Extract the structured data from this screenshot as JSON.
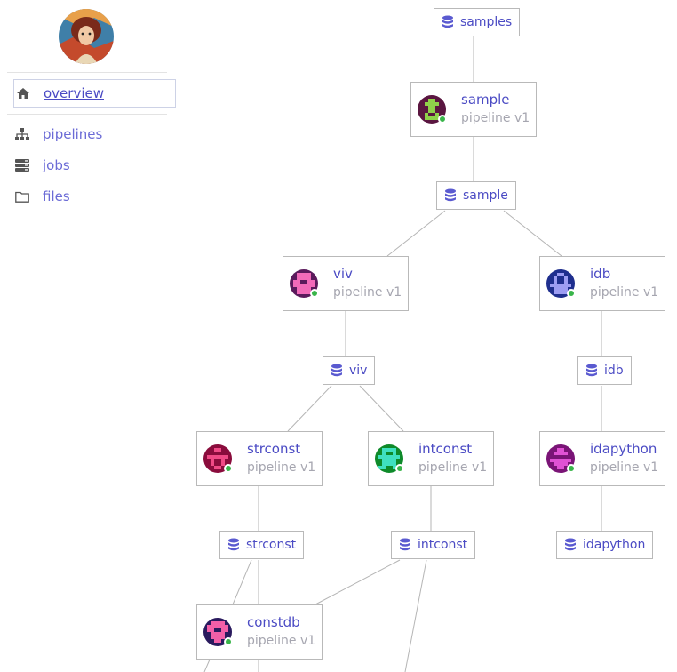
{
  "sidebar": {
    "items": [
      {
        "label": "overview",
        "icon": "home-icon",
        "active": true
      },
      {
        "label": "pipelines",
        "icon": "sitemap-icon"
      },
      {
        "label": "jobs",
        "icon": "server-icon"
      },
      {
        "label": "files",
        "icon": "folder-icon"
      }
    ]
  },
  "graph": {
    "datasets": {
      "samples": "samples",
      "sample": "sample",
      "viv": "viv",
      "idb": "idb",
      "strconst": "strconst",
      "intconst": "intconst",
      "idapython": "idapython"
    },
    "pipelines": {
      "sample": {
        "name": "sample",
        "version": "pipeline v1",
        "avatar_color": "#5a1640",
        "status_color": "#39b54a"
      },
      "viv": {
        "name": "viv",
        "version": "pipeline v1",
        "avatar_color": "#5b1a5c",
        "status_color": "#39b54a"
      },
      "idb": {
        "name": "idb",
        "version": "pipeline v1",
        "avatar_color": "#1f2f8e",
        "status_color": "#39b54a"
      },
      "strconst": {
        "name": "strconst",
        "version": "pipeline v1",
        "avatar_color": "#8a0c3c",
        "status_color": "#39b54a"
      },
      "intconst": {
        "name": "intconst",
        "version": "pipeline v1",
        "avatar_color": "#0e8a2a",
        "status_color": "#39b54a"
      },
      "idapython": {
        "name": "idapython",
        "version": "pipeline v1",
        "avatar_color": "#7a1476",
        "status_color": "#39b54a"
      },
      "constdb": {
        "name": "constdb",
        "version": "pipeline v1",
        "avatar_color": "#2a1a5e",
        "status_color": "#39b54a"
      }
    }
  },
  "colors": {
    "link": "#4b4bc4",
    "muted": "#a6a6b0",
    "border": "#b9b9b9",
    "status": "#39b54a"
  }
}
